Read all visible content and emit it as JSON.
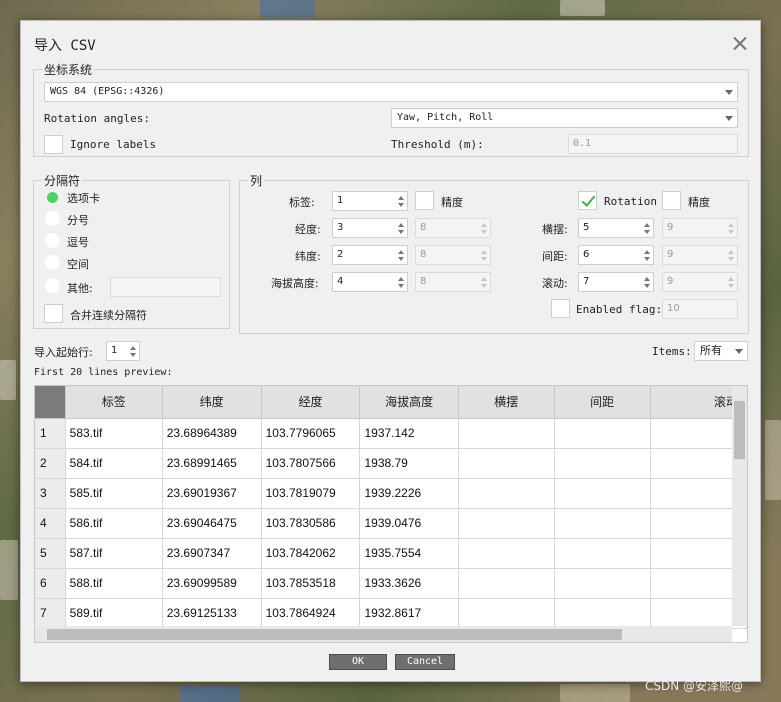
{
  "dialog": {
    "title": "导入 CSV"
  },
  "crs": {
    "legend": "坐标系统",
    "value": "WGS 84 (EPSG::4326)",
    "rotation_label": "Rotation angles:",
    "rotation_value": "Yaw, Pitch, Roll",
    "ignore_labels": "Ignore labels",
    "ignore_checked": false,
    "threshold_label": "Threshold (m):",
    "threshold_value": "0.1"
  },
  "separator": {
    "legend": "分隔符",
    "options": [
      "选项卡",
      "分号",
      "逗号",
      "空间",
      "其他:"
    ],
    "selected": "选项卡",
    "other_value": "",
    "merge_label": "合并连续分隔符",
    "merge_checked": false
  },
  "columns": {
    "legend": "列",
    "label": {
      "name": "标签:",
      "value": "1",
      "precision_label": "精度"
    },
    "lon": {
      "name": "经度:",
      "value": "3",
      "precision": "8"
    },
    "lat": {
      "name": "纬度:",
      "value": "2",
      "precision": "8"
    },
    "alt": {
      "name": "海拔高度:",
      "value": "4",
      "precision": "8"
    },
    "rotation_label": "Rotation",
    "rotation_checked": true,
    "rotation_precision_label": "精度",
    "yaw": {
      "name": "横摆:",
      "value": "5",
      "precision": "9"
    },
    "pitch": {
      "name": "间距:",
      "value": "6",
      "precision": "9"
    },
    "roll": {
      "name": "滚动:",
      "value": "7",
      "precision": "9"
    },
    "enabled_flag_label": "Enabled flag:",
    "enabled_flag_value": "10"
  },
  "import_start": {
    "label": "导入起始行:",
    "value": "1"
  },
  "items": {
    "label": "Items:",
    "value": "所有"
  },
  "preview": {
    "label": "First 20 lines preview:",
    "headers": [
      "标签",
      "纬度",
      "经度",
      "海拔高度",
      "横摆",
      "间距",
      "滚动"
    ],
    "rows": [
      [
        "1",
        "583.tif",
        "23.68964389",
        "103.7796065",
        "1937.142",
        "",
        "",
        ""
      ],
      [
        "2",
        "584.tif",
        "23.68991465",
        "103.7807566",
        "1938.79",
        "",
        "",
        ""
      ],
      [
        "3",
        "585.tif",
        "23.69019367",
        "103.7819079",
        "1939.2226",
        "",
        "",
        ""
      ],
      [
        "4",
        "586.tif",
        "23.69046475",
        "103.7830586",
        "1939.0476",
        "",
        "",
        ""
      ],
      [
        "5",
        "587.tif",
        "23.6907347",
        "103.7842062",
        "1935.7554",
        "",
        "",
        ""
      ],
      [
        "6",
        "588.tif",
        "23.69099589",
        "103.7853518",
        "1933.3626",
        "",
        "",
        ""
      ],
      [
        "7",
        "589.tif",
        "23.69125133",
        "103.7864924",
        "1932.8617",
        "",
        "",
        ""
      ]
    ]
  },
  "buttons": {
    "ok": "OK",
    "cancel": "Cancel"
  },
  "watermark": "CSDN @安泽熙@"
}
